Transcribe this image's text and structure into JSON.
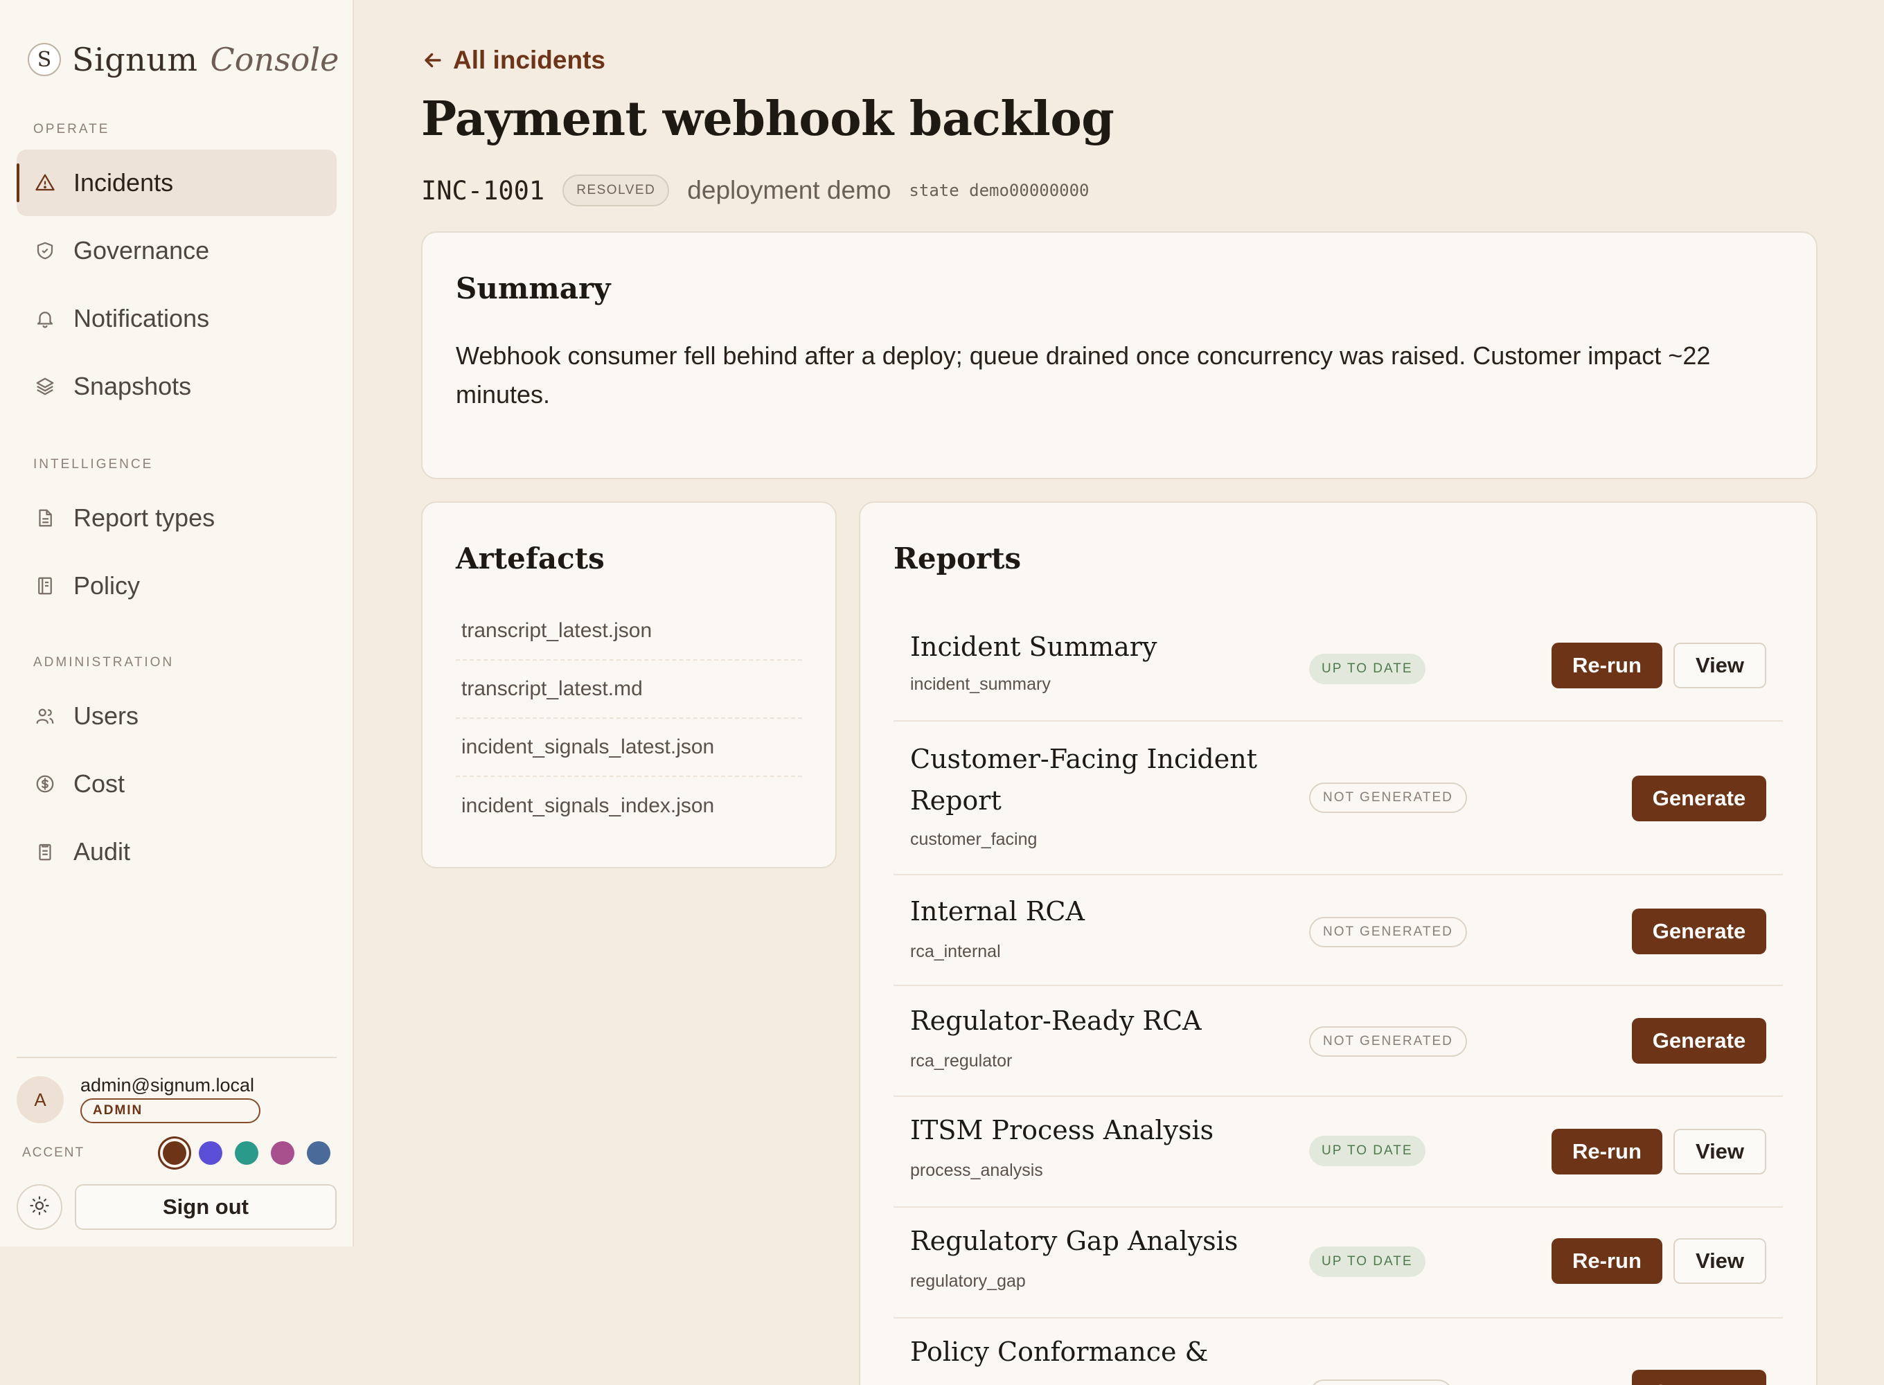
{
  "brand": {
    "logo_letter": "S",
    "name": "Signum",
    "subtitle": "Console"
  },
  "sidebar": {
    "sections": [
      {
        "label": "OPERATE"
      },
      {
        "label": "INTELLIGENCE"
      },
      {
        "label": "ADMINISTRATION"
      }
    ],
    "items": [
      {
        "label": "Incidents",
        "icon": "warning-triangle-icon",
        "active": true
      },
      {
        "label": "Governance",
        "icon": "shield-icon"
      },
      {
        "label": "Notifications",
        "icon": "bell-icon"
      },
      {
        "label": "Snapshots",
        "icon": "layers-icon"
      },
      {
        "label": "Report types",
        "icon": "document-icon"
      },
      {
        "label": "Policy",
        "icon": "book-icon"
      },
      {
        "label": "Users",
        "icon": "users-icon"
      },
      {
        "label": "Cost",
        "icon": "dollar-circle-icon"
      },
      {
        "label": "Audit",
        "icon": "clipboard-icon"
      }
    ],
    "user": {
      "avatar_letter": "A",
      "email": "admin@signum.local",
      "role": "ADMIN"
    },
    "accent": {
      "label": "ACCENT",
      "swatches": [
        "#6e3418",
        "#5a4fd6",
        "#2a9a8a",
        "#a8508e",
        "#4a6a9a"
      ],
      "selected": 0
    },
    "theme_icon": "sun-icon",
    "signout_label": "Sign out"
  },
  "header": {
    "back_label": "All incidents",
    "title": "Payment webhook backlog",
    "incident_id": "INC-1001",
    "status": "RESOLVED",
    "deployment": "deployment demo",
    "state": "state demo00000000"
  },
  "summary": {
    "title": "Summary",
    "text": "Webhook consumer fell behind after a deploy; queue drained once concurrency was raised. Customer impact ~22 minutes."
  },
  "artefacts": {
    "title": "Artefacts",
    "files": [
      "transcript_latest.json",
      "transcript_latest.md",
      "incident_signals_latest.json",
      "incident_signals_index.json"
    ]
  },
  "reports": {
    "title": "Reports",
    "rerun_label": "Re-run",
    "view_label": "View",
    "generate_label": "Generate",
    "items": [
      {
        "name": "Incident Summary",
        "key": "incident_summary",
        "status": "UP TO DATE"
      },
      {
        "name": "Customer-Facing Incident Report",
        "key": "customer_facing",
        "status": "NOT GENERATED"
      },
      {
        "name": "Internal RCA",
        "key": "rca_internal",
        "status": "NOT GENERATED"
      },
      {
        "name": "Regulator-Ready RCA",
        "key": "rca_regulator",
        "status": "NOT GENERATED"
      },
      {
        "name": "ITSM Process Analysis",
        "key": "process_analysis",
        "status": "UP TO DATE"
      },
      {
        "name": "Regulatory Gap Analysis",
        "key": "regulatory_gap",
        "status": "UP TO DATE"
      },
      {
        "name": "Policy Conformance &",
        "key": "",
        "status": ""
      }
    ]
  }
}
